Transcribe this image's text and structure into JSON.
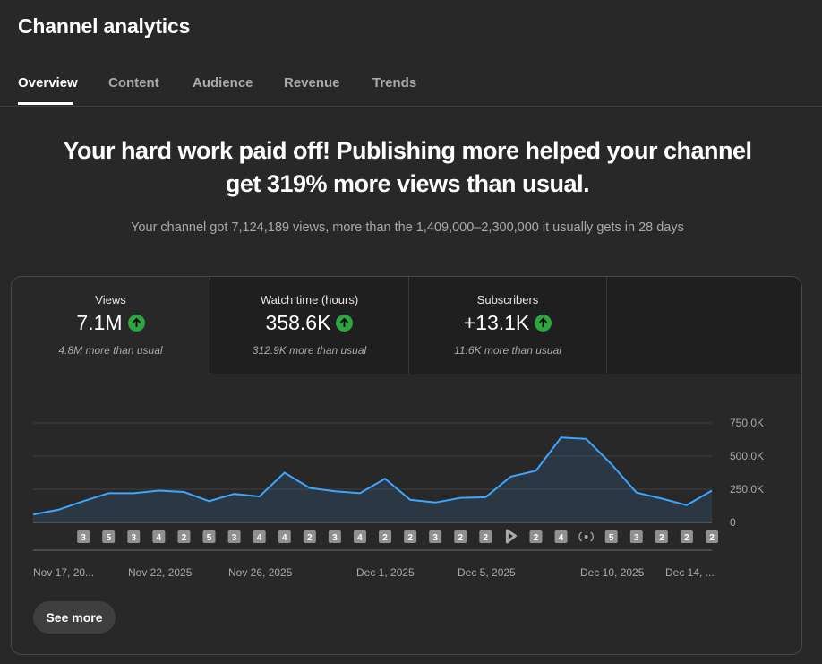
{
  "page": {
    "title": "Channel analytics"
  },
  "tabs": [
    {
      "label": "Overview"
    },
    {
      "label": "Content"
    },
    {
      "label": "Audience"
    },
    {
      "label": "Revenue"
    },
    {
      "label": "Trends"
    }
  ],
  "headline": {
    "line1": "Your hard work paid off! Publishing more helped your channel",
    "line2": "get 319% more views than usual.",
    "subtext": "Your channel got 7,124,189 views, more than the 1,409,000–2,300,000 it usually gets in 28 days"
  },
  "metrics": [
    {
      "label": "Views",
      "value": "7.1M",
      "sub": "4.8M more than usual",
      "trend_icon": "arrow-up-icon"
    },
    {
      "label": "Watch time (hours)",
      "value": "358.6K",
      "sub": "312.9K more than usual",
      "trend_icon": "arrow-up-icon"
    },
    {
      "label": "Subscribers",
      "value": "+13.1K",
      "sub": "11.6K more than usual",
      "trend_icon": "arrow-up-icon"
    }
  ],
  "see_more_label": "See more",
  "colors": {
    "accent_line": "#3ea6ff",
    "positive": "#2ba640",
    "background": "#282828"
  },
  "chart_data": {
    "type": "area",
    "y_ticks": [
      "750.0K",
      "500.0K",
      "250.0K",
      "0"
    ],
    "ylim": [
      0,
      750000
    ],
    "x_tick_labels": [
      "Nov 17, 20...",
      "Nov 22, 2025",
      "Nov 26, 2025",
      "Dec 1, 2025",
      "Dec 5, 2025",
      "Dec 10, 2025",
      "Dec 14, ..."
    ],
    "series": [
      {
        "values": [
          60000,
          95000,
          160000,
          220000,
          220000,
          240000,
          230000,
          160000,
          215000,
          195000,
          375000,
          260000,
          235000,
          220000,
          330000,
          170000,
          150000,
          185000,
          190000,
          345000,
          390000,
          640000,
          630000,
          440000,
          225000,
          180000,
          130000,
          240000
        ]
      }
    ],
    "markers": [
      "",
      "",
      "3",
      "5",
      "3",
      "4",
      "2",
      "5",
      "3",
      "4",
      "4",
      "2",
      "3",
      "4",
      "2",
      "2",
      "3",
      "2",
      "2",
      "shorts-icon",
      "2",
      "4",
      "live-icon",
      "5",
      "3",
      "2",
      "2",
      "2"
    ]
  }
}
